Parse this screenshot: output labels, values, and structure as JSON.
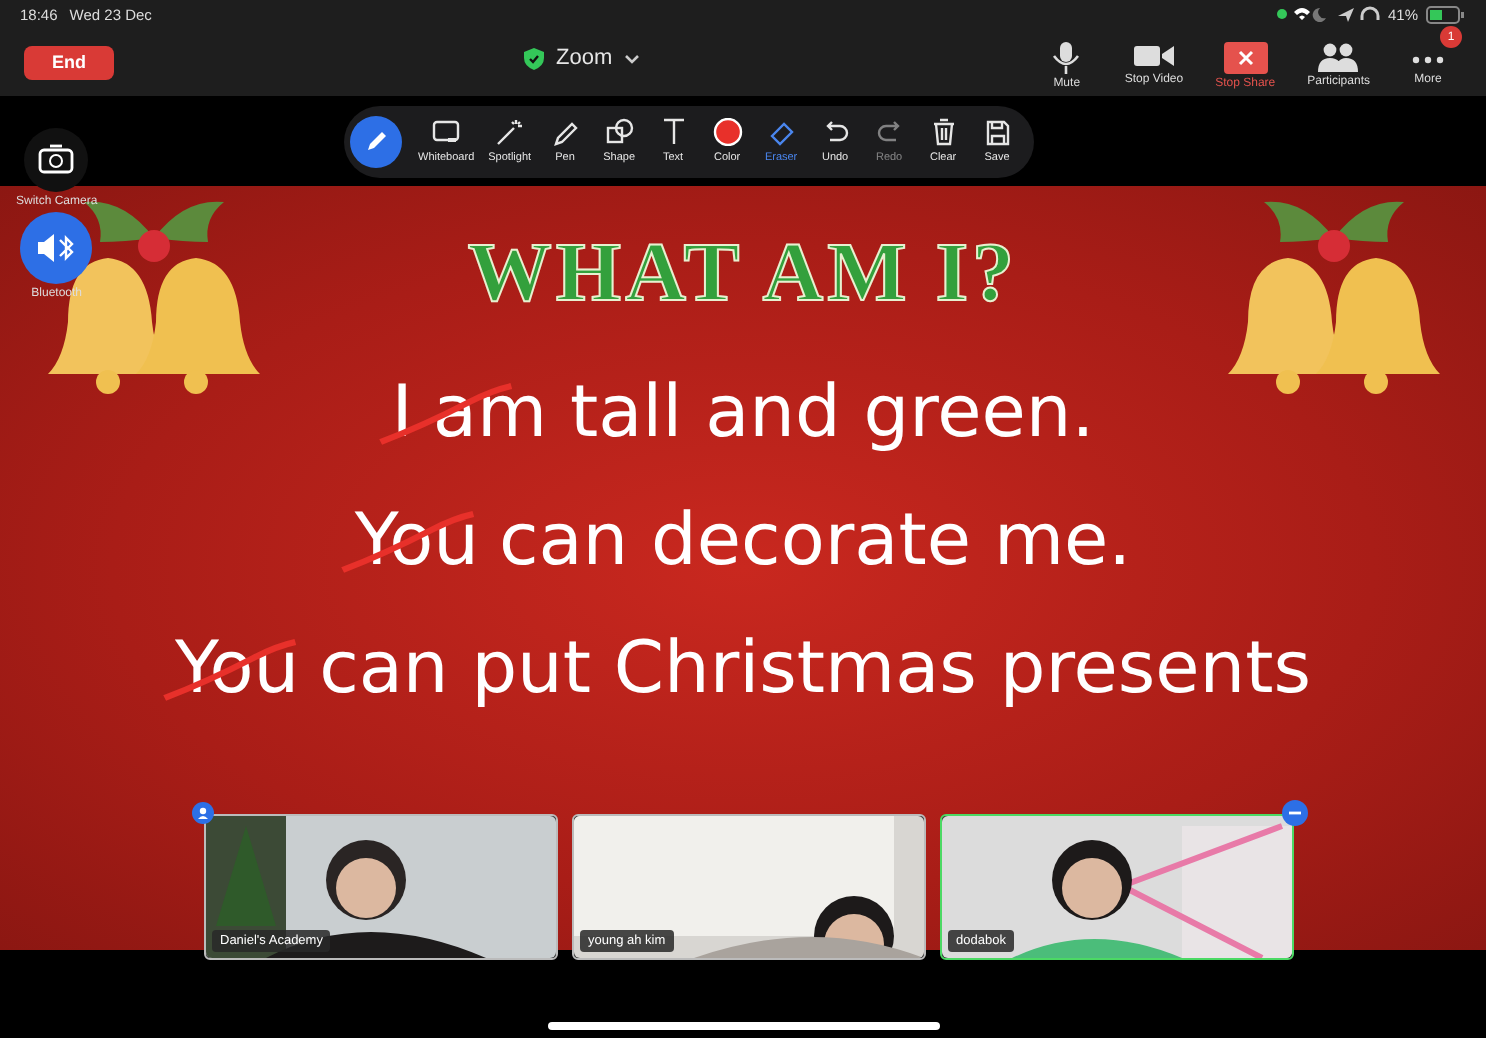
{
  "status_bar": {
    "time": "18:46",
    "date": "Wed 23 Dec",
    "battery": "41%"
  },
  "top_bar": {
    "end_button": "End",
    "meeting_title": "Zoom",
    "controls": [
      {
        "kind": "mute",
        "label": "Mute",
        "active": false
      },
      {
        "kind": "video",
        "label": "Stop Video",
        "active": false
      },
      {
        "kind": "share",
        "label": "Stop Share",
        "active": true
      },
      {
        "kind": "participants",
        "label": "Participants",
        "active": false
      },
      {
        "kind": "more",
        "label": "More",
        "active": false,
        "badge": "1"
      }
    ]
  },
  "annotation_toolbar": {
    "tools": [
      {
        "kind": "whiteboard",
        "label": "Whiteboard",
        "selected": false,
        "disabled": false
      },
      {
        "kind": "spotlight",
        "label": "Spotlight",
        "selected": false,
        "disabled": false
      },
      {
        "kind": "pen",
        "label": "Pen",
        "selected": false,
        "disabled": false
      },
      {
        "kind": "shape",
        "label": "Shape",
        "selected": false,
        "disabled": false
      },
      {
        "kind": "text",
        "label": "Text",
        "selected": false,
        "disabled": false
      },
      {
        "kind": "color",
        "label": "Color",
        "selected": false,
        "disabled": false,
        "color": "#e8302a"
      },
      {
        "kind": "eraser",
        "label": "Eraser",
        "selected": true,
        "disabled": false
      },
      {
        "kind": "undo",
        "label": "Undo",
        "selected": false,
        "disabled": false
      },
      {
        "kind": "redo",
        "label": "Redo",
        "selected": false,
        "disabled": true
      },
      {
        "kind": "clear",
        "label": "Clear",
        "selected": false,
        "disabled": false
      },
      {
        "kind": "save",
        "label": "Save",
        "selected": false,
        "disabled": false
      }
    ]
  },
  "side_buttons": [
    {
      "kind": "camera",
      "label": "Switch Camera"
    },
    {
      "kind": "bluetooth",
      "label": "Bluetooth"
    }
  ],
  "slide": {
    "title": "WHAT AM I?",
    "lines": [
      {
        "lead": "I",
        "text": "am tall and green.",
        "struck": true
      },
      {
        "lead": "You",
        "text": "can decorate me.",
        "struck": true
      },
      {
        "lead": "You",
        "text": "can put Christmas presents",
        "struck": true
      }
    ]
  },
  "video_tiles": [
    {
      "name": "Daniel's Academy",
      "active": false,
      "pinned": true
    },
    {
      "name": "young ah kim",
      "active": false,
      "pinned": false
    },
    {
      "name": "dodabok",
      "active": true,
      "pinned": false
    }
  ]
}
